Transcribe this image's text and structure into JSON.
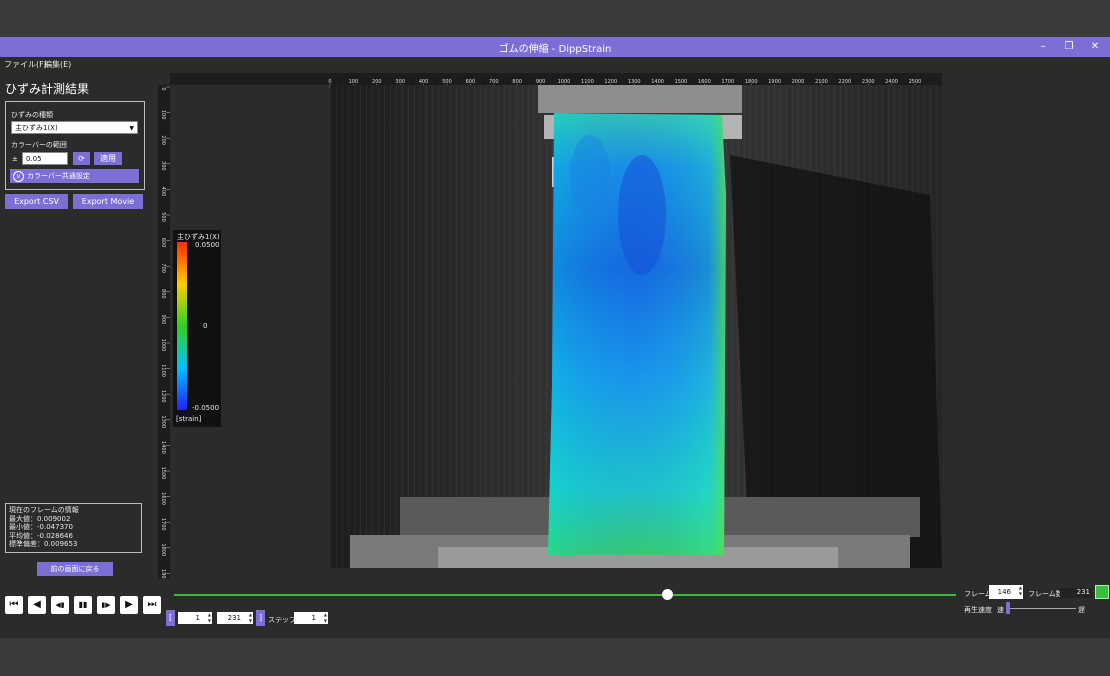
{
  "window": {
    "title": "ゴムの伸縮 - DippStrain",
    "minimize": "–",
    "maximize": "❐",
    "close": "✕"
  },
  "menu": {
    "file": "ファイル(F)",
    "edit": "編集(E)"
  },
  "panel": {
    "title": "ひずみ計測結果",
    "strain_type_label": "ひずみの種類",
    "strain_type_value": "主ひずみ1(X)",
    "range_label": "カラーバーの範囲",
    "pm": "±",
    "range_value": "0.05",
    "apply": "適用",
    "colorbar_common": "カラーバー共通設定",
    "export_csv": "Export CSV",
    "export_movie": "Export Movie",
    "back": "前の画面に戻る"
  },
  "frame_info": {
    "title": "現在のフレームの情報",
    "max": "最大値：0.009002",
    "min": "最小値：-0.047370",
    "mean": "平均値：-0.028646",
    "std": "標準偏差：0.009653"
  },
  "colorbar": {
    "title": "主ひずみ1(X)",
    "max": "0.0500",
    "mid": "0",
    "min": "-0.0500",
    "unit": "[strain]",
    "top_color": "#ff2a00",
    "bottom_color": "#2020ff"
  },
  "ruler": {
    "top_ticks": [
      "0",
      "100",
      "200",
      "300",
      "400",
      "500",
      "600",
      "700",
      "800",
      "900",
      "1000",
      "1100",
      "1200",
      "1300",
      "1400",
      "1500",
      "1600",
      "1700",
      "1800",
      "1900",
      "2000",
      "2100",
      "2200",
      "2300",
      "2400",
      "2500"
    ],
    "left_ticks": [
      "0",
      "100",
      "200",
      "300",
      "400",
      "500",
      "600",
      "700",
      "800",
      "900",
      "1000",
      "1100",
      "1200",
      "1300",
      "1400",
      "1500",
      "1600",
      "1700",
      "1800",
      "1900"
    ]
  },
  "playback": {
    "frame_label": "フレーム",
    "frame_value": "146",
    "frame_count_label": "フレーム数",
    "frame_count_value": "231",
    "speed_label": "再生速度",
    "speed_fast": "速",
    "speed_slow": "遅",
    "start_value": "1",
    "end_value": "231",
    "step_label": "ステップ",
    "step_value": "1",
    "bracket_open": "[",
    "bracket_close": "]",
    "progress": 0.63,
    "speed_position": 0.0,
    "accent": "#3dbb3d"
  },
  "controls": {
    "first": "⏮",
    "prev": "◀",
    "step_back": "◀▮",
    "pause": "▮▮",
    "step_fwd": "▮▶",
    "play": "▶",
    "last": "⏭"
  }
}
